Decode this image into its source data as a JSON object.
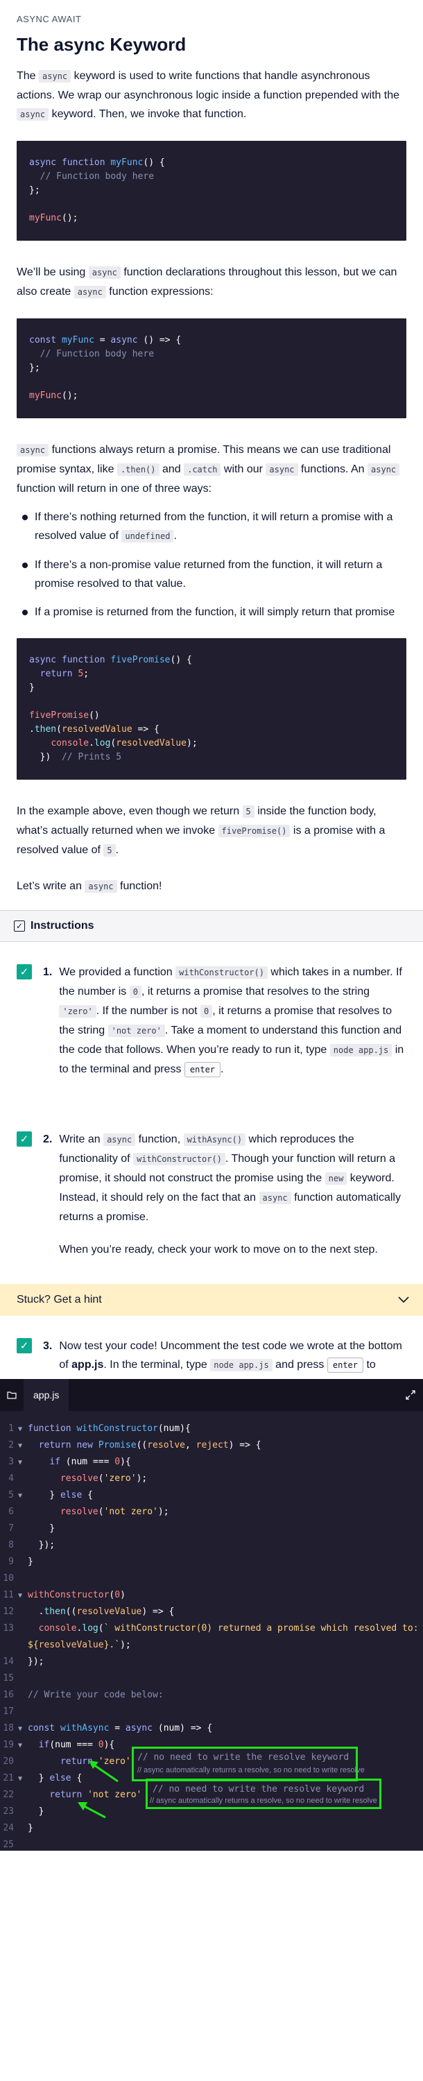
{
  "lesson": {
    "eyebrow": "ASYNC AWAIT",
    "title": "The async Keyword",
    "p1": {
      "a": "The ",
      "c1": "async",
      "b": " keyword is used to write functions that handle asynchronous actions. We wrap our asynchronous logic inside a function prepended with the ",
      "c2": "async",
      "d": " keyword. Then, we invoke that function."
    },
    "p2": {
      "a": "We’ll be using ",
      "c1": "async",
      "b": " function declarations throughout this lesson, but we can also create ",
      "c2": "async",
      "d": " function expressions:"
    },
    "p3": {
      "c1": "async",
      "a": " functions always return a promise. This means we can use traditional promise syntax, like ",
      "c2": ".then()",
      "b": " and ",
      "c3": ".catch",
      "d": " with our ",
      "c4": "async",
      "e": " functions. An ",
      "c5": "async",
      "f": " function will return in one of three ways:"
    },
    "bullets": [
      {
        "a": "If there’s nothing returned from the function, it will return a promise with a resolved value of ",
        "c": "undefined",
        "b": "."
      },
      {
        "a": "If there’s a non-promise value returned from the function, it will return a promise resolved to that value."
      },
      {
        "a": "If a promise is returned from the function, it will simply return that promise"
      }
    ],
    "p4": {
      "a": "In the example above, even though we return ",
      "c1": "5",
      "b": " inside the function body, what’s actually returned when we invoke ",
      "c2": "fivePromise()",
      "d": " is a promise with a resolved value of ",
      "c3": "5",
      "e": "."
    },
    "p5": {
      "a": "Let’s write an ",
      "c1": "async",
      "b": " function!"
    }
  },
  "instructions": {
    "title": "Instructions",
    "tasks": [
      {
        "number": "1.",
        "a": "We provided a function ",
        "c1": "withConstructor()",
        "b": " which takes in a number. If the number is ",
        "c2": "0",
        "d": ", it returns a promise that resolves to the string ",
        "c3": "'zero'",
        "e": ". If the number is not ",
        "c4": "0",
        "f": ", it returns a promise that resolves to the string ",
        "c5": "'not zero'",
        "g": ". Take a moment to understand this function and the code that follows. When you’re ready to run it, type ",
        "c6": "node app.js",
        "h": " in to the terminal and press ",
        "k": "enter",
        "i": "."
      },
      {
        "number": "2.",
        "a": "Write an ",
        "c1": "async",
        "b": " function, ",
        "c2": "withAsync()",
        "d": " which reproduces the functionality of ",
        "c3": "withConstructor()",
        "e": ". Though your function will return a promise, it should not construct the promise using the ",
        "c4": "new",
        "f": " keyword. Instead, it should rely on the fact that an ",
        "c5": "async",
        "g": " function automatically returns a promise.",
        "p2": "When you’re ready, check your work to move on to the next step."
      },
      {
        "number": "3.",
        "a": "Now test your code! Uncomment the test code we wrote at the bottom of ",
        "bold": "app.js",
        "b": ". In the terminal, type ",
        "c1": "node app.js",
        "d": " and press ",
        "k": "enter",
        "e": " to execute the code."
      }
    ],
    "hint": "Stuck? Get a hint"
  },
  "editor": {
    "tab": "app.js",
    "annotations": {
      "a1": "// no need to write the resolve keyword",
      "n1": "// async automatically returns a resolve, so no need to write resolve",
      "a2": "// no need to write the resolve keyword",
      "n2": "// async automatically returns a resolve, so no need to write resolve"
    }
  },
  "colors": {
    "accent": "#0ca98e",
    "code_bg": "#211e2f",
    "hint_bg": "#fff0c8",
    "annotation": "#1ee31a"
  }
}
